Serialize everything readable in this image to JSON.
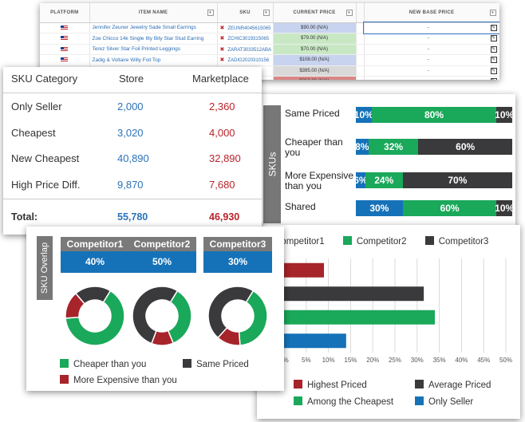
{
  "table": {
    "headers": [
      "PLATFORM",
      "ITEM NAME",
      "SKU",
      "CURRENT PRICE",
      "NEW BASE PRICE"
    ],
    "rows": [
      {
        "item": "Jennifer Zeuner Jewelry Sade Small Earrings",
        "sku": "ZEUNR4045615065",
        "price": "$90.00 (N/A)",
        "base": "-",
        "price_color": "#c7d3ef"
      },
      {
        "item": "Zoe Chicco 14k Single Itty Bity Star Stud Earring",
        "sku": "ZCHIC3019315065",
        "price": "$79.00 (N/A)",
        "base": "-",
        "price_color": "#c8e8c4"
      },
      {
        "item": "Terez Silver Star Foil Printed Leggings",
        "sku": "ZARAT3033512ABA",
        "price": "$70.00 (N/A)",
        "base": "-",
        "price_color": "#c8e8c4"
      },
      {
        "item": "Zadig & Voltaire Willy Foil Top",
        "sku": "ZADIG2020310156",
        "price": "$108.00 (N/A)",
        "base": "-",
        "price_color": "#c7d3ef"
      },
      {
        "item": "",
        "sku": "",
        "price": "$395.00 (N/A)",
        "base": "-",
        "price_color": "#d9d9d9"
      },
      {
        "item": "",
        "sku": "",
        "price": "$350.00 (N/A)",
        "base": "-",
        "price_color": "#d98585"
      }
    ]
  },
  "category": {
    "headers": {
      "category": "SKU Category",
      "store": "Store",
      "marketplace": "Marketplace"
    },
    "rows": [
      {
        "label": "Only Seller",
        "store": "2,000",
        "market": "2,360"
      },
      {
        "label": "Cheapest",
        "store": "3,020",
        "market": "4,000"
      },
      {
        "label": "New Cheapest",
        "store": "40,890",
        "market": "32,890"
      },
      {
        "label": "High Price Diff.",
        "store": "9,870",
        "market": "7,680"
      }
    ],
    "total": {
      "label": "Total:",
      "store": "55,780",
      "market": "46,930"
    }
  },
  "skus": {
    "title": "SKUs",
    "rows": [
      {
        "label": "Same Priced",
        "segments": [
          10,
          80,
          10
        ]
      },
      {
        "label": "Cheaper than you",
        "segments": [
          8,
          32,
          60
        ]
      },
      {
        "label": "More Expensive than you",
        "segments": [
          6,
          24,
          70
        ]
      },
      {
        "label": "Shared",
        "segments": [
          30,
          60,
          10
        ]
      }
    ],
    "colors": [
      "#1672b8",
      "#1aa85a",
      "#3a3a3c"
    ]
  },
  "competitor_legend": [
    "Competitor1",
    "Competitor2",
    "Competitor3"
  ],
  "overlap": {
    "title": "SKU Overlap",
    "competitors": [
      {
        "name": "Competitor1",
        "pct": "40%",
        "slices": [
          {
            "v": 65,
            "c": "#1aa85a"
          },
          {
            "v": 15,
            "c": "#a6242a"
          },
          {
            "v": 20,
            "c": "#3a3a3c"
          }
        ]
      },
      {
        "name": "Competitor2",
        "pct": "50%",
        "slices": [
          {
            "v": 35,
            "c": "#1aa85a"
          },
          {
            "v": 12,
            "c": "#a6242a"
          },
          {
            "v": 53,
            "c": "#3a3a3c"
          }
        ]
      },
      {
        "name": "Competitor3",
        "pct": "30%",
        "slices": [
          {
            "v": 40,
            "c": "#1aa85a"
          },
          {
            "v": 13,
            "c": "#a6242a"
          },
          {
            "v": 47,
            "c": "#3a3a3c"
          }
        ]
      }
    ],
    "legend": {
      "cheaper": "Cheaper than you",
      "same": "Same Priced",
      "expensive": "More Expensive than you"
    }
  },
  "chart_data": {
    "type": "bar",
    "orientation": "horizontal",
    "categories": [
      "Highest Priced",
      "Average Priced",
      "Among the Cheapest",
      "Only Seller"
    ],
    "values": [
      9,
      31.5,
      34,
      14
    ],
    "colors": [
      "#a6242a",
      "#3a3a3c",
      "#1aa85a",
      "#1672b8"
    ],
    "xlim": [
      0,
      50
    ],
    "xticks": [
      "0%",
      "5%",
      "10%",
      "15%",
      "20%",
      "25%",
      "30%",
      "35%",
      "40%",
      "45%",
      "50%"
    ],
    "grid": true,
    "legend_position": "bottom"
  }
}
